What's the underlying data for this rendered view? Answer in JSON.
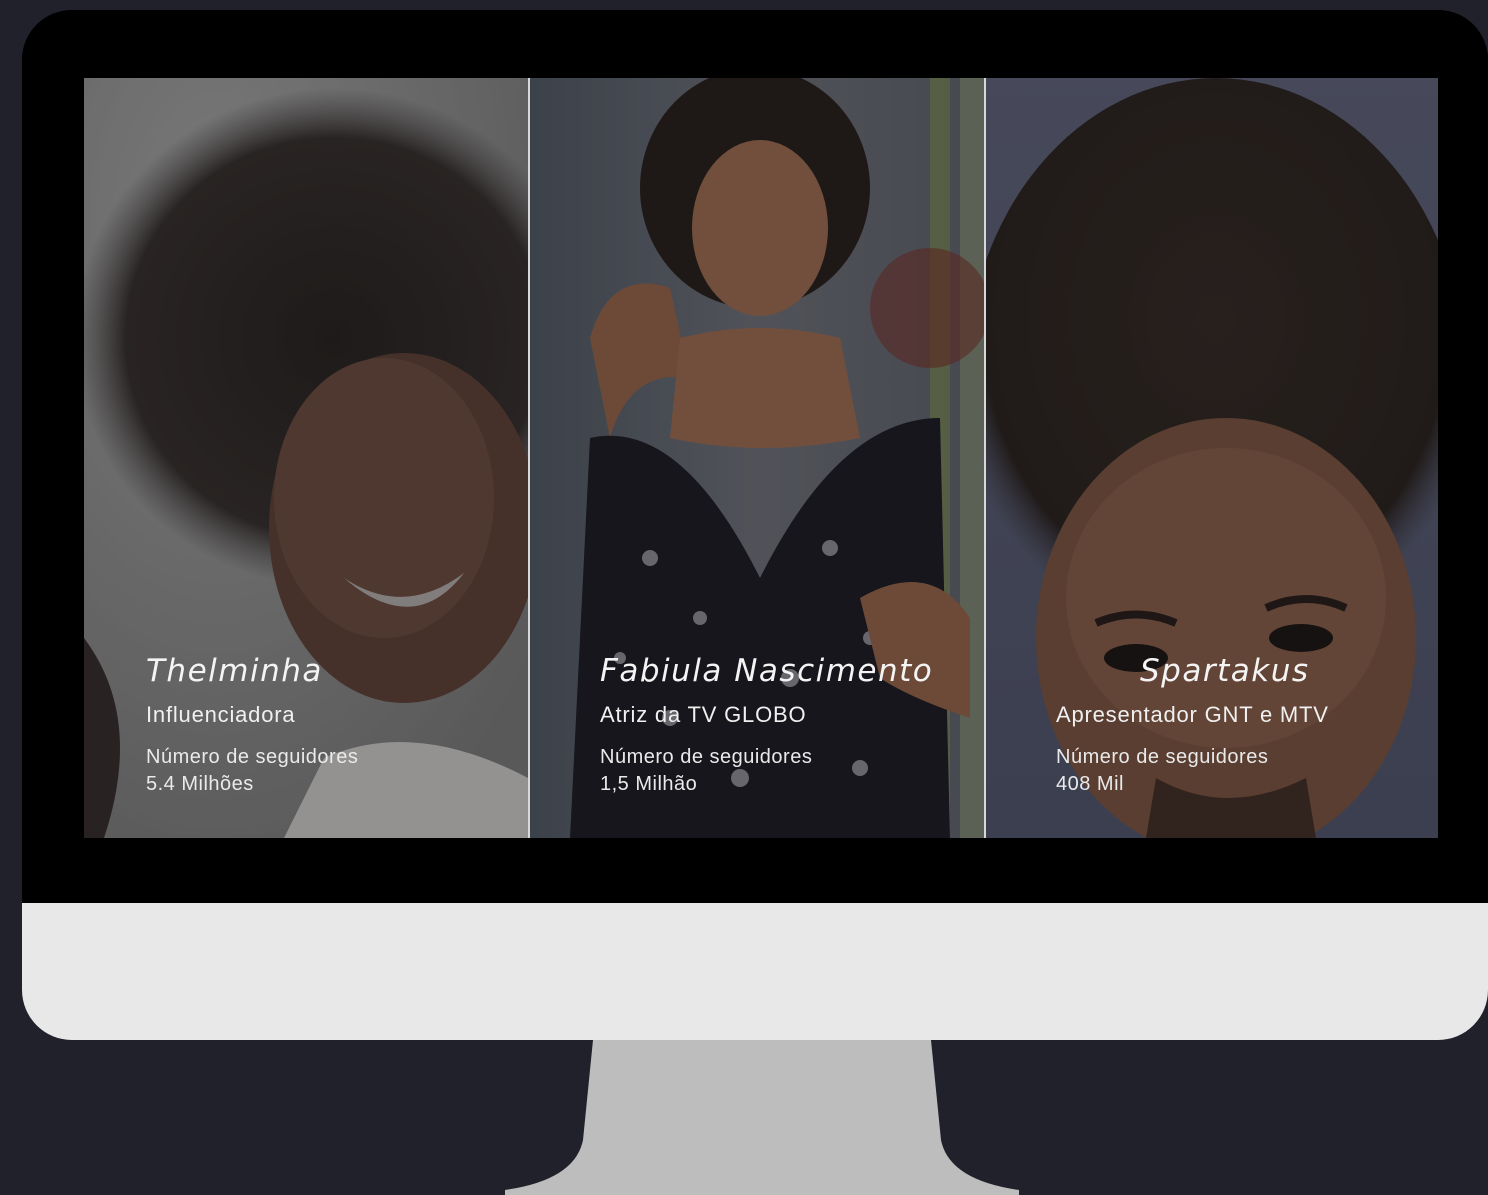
{
  "profiles": [
    {
      "name": "Thelminha",
      "role": "Influenciadora",
      "followers_label": "Número de seguidores",
      "followers_value": "5.4 Milhões"
    },
    {
      "name": "Fabiula Nascimento",
      "role": "Atriz da TV GLOBO",
      "followers_label": "Número de seguidores",
      "followers_value": "1,5 Milhão"
    },
    {
      "name": "Spartakus",
      "role": "Apresentador GNT e MTV",
      "followers_label": "Número de seguidores",
      "followers_value": "408 Mil"
    }
  ],
  "colors": {
    "background": "#20212b",
    "bezel": "#000000",
    "chin": "#e8e8e8",
    "stand": "#bdbdbd",
    "divider": "#d8d8d8"
  }
}
